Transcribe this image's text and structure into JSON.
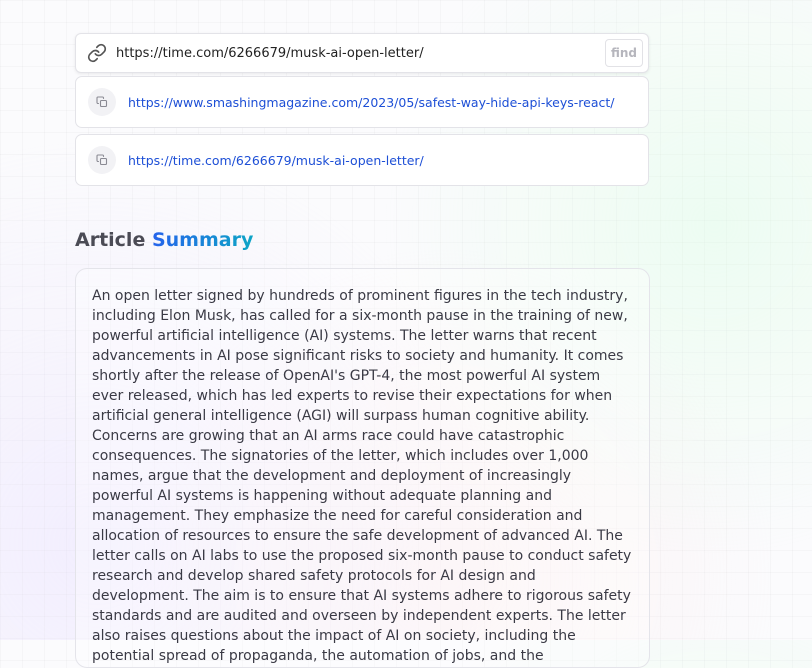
{
  "search": {
    "icon": "link-icon",
    "value": "https://time.com/6266679/musk-ai-open-letter/",
    "button_label": "find"
  },
  "history": [
    {
      "icon": "copy-icon",
      "url": "https://www.smashingmagazine.com/2023/05/safest-way-hide-api-keys-react/"
    },
    {
      "icon": "copy-icon",
      "url": "https://time.com/6266679/musk-ai-open-letter/"
    }
  ],
  "section": {
    "title_prefix": "Article",
    "title_accent": "Summary"
  },
  "summary": {
    "text": "An open letter signed by hundreds of prominent figures in the tech industry, including Elon Musk, has called for a six-month pause in the training of new, powerful artificial intelligence (AI) systems. The letter warns that recent advancements in AI pose significant risks to society and humanity. It comes shortly after the release of OpenAI's GPT-4, the most powerful AI system ever released, which has led experts to revise their expectations for when artificial general intelligence (AGI) will surpass human cognitive ability. Concerns are growing that an AI arms race could have catastrophic consequences. The signatories of the letter, which includes over 1,000 names, argue that the development and deployment of increasingly powerful AI systems is happening without adequate planning and management. They emphasize the need for careful consideration and allocation of resources to ensure the safe development of advanced AI. The letter calls on AI labs to use the proposed six-month pause to conduct safety research and develop shared safety protocols for AI design and development. The aim is to ensure that AI systems adhere to rigorous safety standards and are audited and overseen by independent experts. The letter also raises questions about the impact of AI on society, including the potential spread of propaganda, the automation of jobs, and the development of nonhuman minds"
  },
  "colors": {
    "link": "#1d4fd6",
    "accent_start": "#2563eb",
    "accent_end": "#0ea5c6",
    "heading": "#4b4b55",
    "text": "#3a3a45"
  }
}
